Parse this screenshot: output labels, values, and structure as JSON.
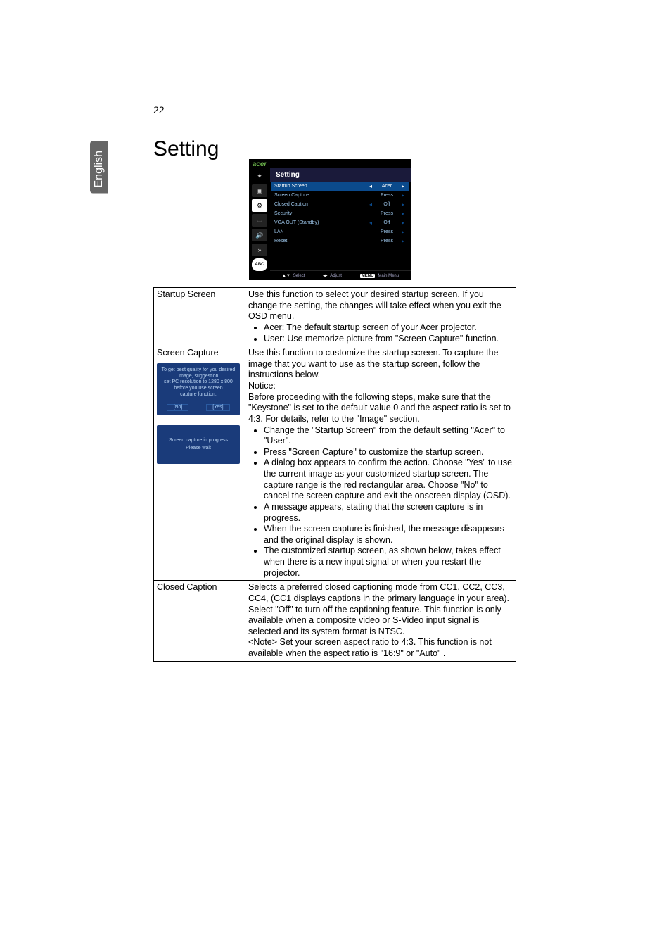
{
  "page_number": "22",
  "language_tab": "English",
  "heading": "Setting",
  "osd": {
    "brand": "acer",
    "title": "Setting",
    "sidebar_tabs": [
      {
        "name": "empower-icon",
        "glyph": "✦"
      },
      {
        "name": "image-icon",
        "glyph": "▣"
      },
      {
        "name": "settings-icon",
        "glyph": "⚙",
        "active": true
      },
      {
        "name": "management-icon",
        "glyph": "▭"
      },
      {
        "name": "audio-icon",
        "glyph": "🔊"
      },
      {
        "name": "timer-icon",
        "glyph": "»"
      },
      {
        "name": "language-icon",
        "glyph": "ABC",
        "abc": true
      }
    ],
    "rows": [
      {
        "label": "Startup Screen",
        "left": "◂",
        "value": "Acer",
        "right": "▸",
        "hl": true
      },
      {
        "label": "Screen Capture",
        "left": "",
        "value": "Press",
        "right": "▸"
      },
      {
        "label": "Closed Caption",
        "left": "◂",
        "value": "Off",
        "right": "▸"
      },
      {
        "label": "Security",
        "left": "",
        "value": "Press",
        "right": "▸"
      },
      {
        "label": "VGA OUT (Standby)",
        "left": "◂",
        "value": "Off",
        "right": "▸"
      },
      {
        "label": "LAN",
        "left": "",
        "value": "Press",
        "right": "▸"
      },
      {
        "label": "Reset",
        "left": "",
        "value": "Press",
        "right": "▸"
      }
    ],
    "footer": [
      {
        "key": "▲▼",
        "label": "Select"
      },
      {
        "key": "◂▸",
        "label": "Adjust"
      },
      {
        "key": "MENU",
        "label": "Main Menu",
        "menu": true
      }
    ]
  },
  "rows": [
    {
      "name": "Startup Screen",
      "body": "Use this function to select your desired startup screen. If you change the setting, the changes will take effect when you exit the OSD menu.",
      "bullets": [
        "Acer: The default startup screen of your Acer projector.",
        "User: Use memorize picture from \"Screen Capture\" function."
      ]
    }
  ],
  "screen_capture": {
    "name": "Screen Capture",
    "dialog1_l1": "To get best quality for you desired image, suggestion",
    "dialog1_l2": "set PC resolution to 1280 x 800 before you use screen",
    "dialog1_l3": "capture function.",
    "dialog1_no": "[No]",
    "dialog1_yes": "[Yes]",
    "dialog2_l1": "Screen capture in progress",
    "dialog2_l2": "Please wait",
    "p1": "Use this function to customize the startup screen. To capture the image that you want to use as the startup screen, follow the instructions below.",
    "p2": "Notice:",
    "p3": "Before proceeding with the following steps, make sure that the \"Keystone\" is set to the default value 0 and the aspect ratio is set to 4:3. For details, refer to the \"Image\" section.",
    "bullets": [
      "Change the \"Startup Screen\" from the default setting \"Acer\" to \"User\".",
      "Press \"Screen Capture\" to customize the startup screen.",
      "A dialog box appears to confirm the action. Choose \"Yes\" to use the current image as your customized startup screen. The capture range is the red rectangular area. Choose \"No\" to cancel the screen capture and exit the onscreen display (OSD).",
      "A message appears, stating that the screen capture is in progress.",
      "When the screen capture is finished, the message disappears and the original display is shown.",
      "The customized startup screen, as shown below, takes effect when there is a new input signal or when you restart the projector."
    ]
  },
  "closed_caption": {
    "name": "Closed Caption",
    "p1": "Selects a preferred closed captioning mode from CC1, CC2, CC3, CC4, (CC1 displays captions in the primary language in your area). Select \"Off\" to turn off the captioning feature. This function is only available when a composite video or S-Video input signal is selected and its system format is NTSC.",
    "p2": "<Note> Set your screen aspect ratio to 4:3. This function is not available when the aspect ratio is \"16:9\" or \"Auto\" ."
  }
}
